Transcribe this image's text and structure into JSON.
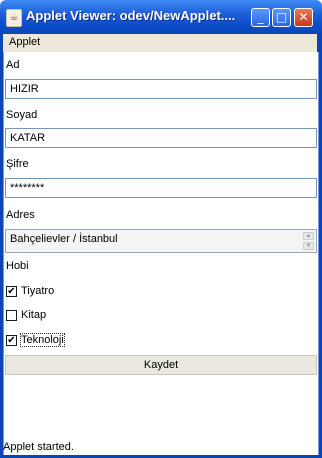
{
  "window": {
    "title": "Applet Viewer: odev/NewApplet....",
    "icon": "java-cup-icon",
    "minimize_glyph": "_",
    "maximize_glyph": "□",
    "close_glyph": "✕"
  },
  "menubar": {
    "applet": "Applet"
  },
  "form": {
    "ad_label": "Ad",
    "ad_value": "HIZIR",
    "soyad_label": "Soyad",
    "soyad_value": "KATAR",
    "sifre_label": "Şifre",
    "sifre_value": "********",
    "adres_label": "Adres",
    "adres_value": "Bahçelievler / İstanbul",
    "hobi_label": "Hobi",
    "hobbies": [
      {
        "label": "Tiyatro",
        "checked": true,
        "mark": "✔"
      },
      {
        "label": "Kitap",
        "checked": false,
        "mark": ""
      },
      {
        "label": "Teknoloji",
        "checked": true,
        "mark": "✔"
      }
    ],
    "save_label": "Kaydet"
  },
  "status": {
    "text": "Applet started."
  }
}
